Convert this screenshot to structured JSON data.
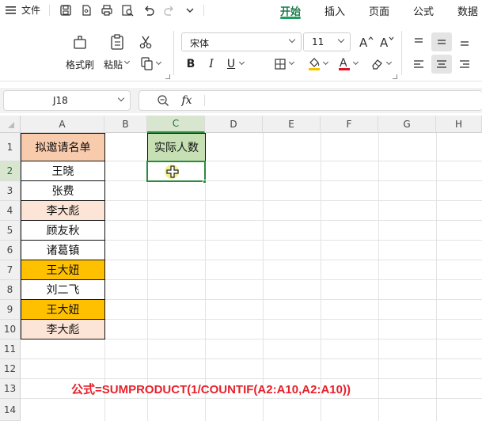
{
  "menubar": {
    "file_label": "文件",
    "tabs": [
      {
        "label": "开始",
        "active": true
      },
      {
        "label": "插入",
        "active": false
      },
      {
        "label": "页面",
        "active": false
      },
      {
        "label": "公式",
        "active": false
      },
      {
        "label": "数据",
        "active": false
      }
    ]
  },
  "ribbon": {
    "format_painter_label": "格式刷",
    "paste_label": "粘贴",
    "font_name": "宋体",
    "font_size": "11",
    "colors": {
      "font_color": "#e81123",
      "fill_color": "#f5c400",
      "accent": "#1f9e5b"
    }
  },
  "formulabar": {
    "name_box": "J18",
    "fx_label": "fx",
    "content": ""
  },
  "grid": {
    "columns": [
      "A",
      "B",
      "C",
      "D",
      "E",
      "F",
      "G",
      "H"
    ],
    "selected_column": "C",
    "rows": [
      "1",
      "2",
      "3",
      "4",
      "5",
      "6",
      "7",
      "8",
      "9",
      "10",
      "11",
      "12",
      "13",
      "14"
    ],
    "selected_row": "2",
    "header_a": "拟邀请名单",
    "header_c": "实际人数",
    "names": [
      {
        "text": "王晓",
        "fill": "#ffffff"
      },
      {
        "text": "张费",
        "fill": "#ffffff"
      },
      {
        "text": "李大彪",
        "fill": "#fce4d6"
      },
      {
        "text": "顾友秋",
        "fill": "#ffffff"
      },
      {
        "text": "诸葛镇",
        "fill": "#ffffff"
      },
      {
        "text": "王大妞",
        "fill": "#ffc000"
      },
      {
        "text": "刘二飞",
        "fill": "#ffffff"
      },
      {
        "text": "王大妞",
        "fill": "#ffc000"
      },
      {
        "text": "李大彪",
        "fill": "#fce4d6"
      }
    ],
    "header_a_fill": "#f8cbad",
    "header_c_fill": "#c6e0b4",
    "formula_note": "公式=SUMPRODUCT(1/COUNTIF(A2:A10,A2:A10))"
  }
}
